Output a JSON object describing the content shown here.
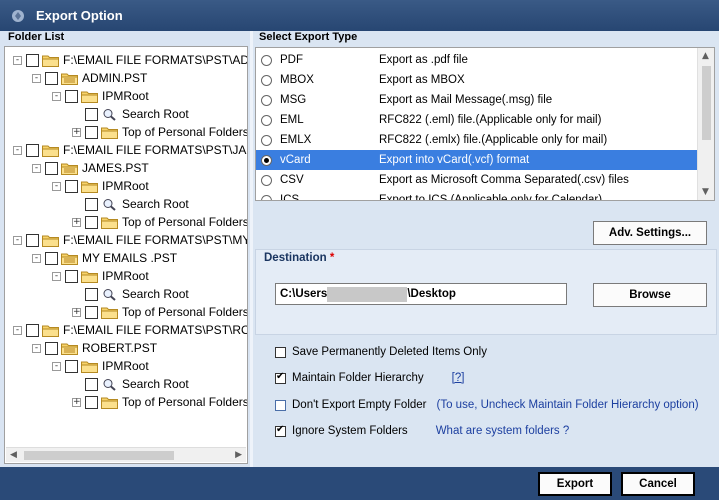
{
  "window": {
    "title": "Export Option"
  },
  "folder_list": {
    "header": "Folder List",
    "tree": [
      {
        "label": "F:\\EMAIL FILE FORMATS\\PST\\ADMIN.PST",
        "level": 0,
        "expander": "-",
        "folder": true
      },
      {
        "label": "ADMIN.PST",
        "level": 1,
        "expander": "-",
        "folder": true,
        "pst": true
      },
      {
        "label": "IPMRoot",
        "level": 2,
        "expander": "-",
        "folder": true
      },
      {
        "label": "Search Root",
        "level": 3,
        "expander": "",
        "search": true
      },
      {
        "label": "Top of Personal Folders",
        "level": 3,
        "expander": "+",
        "folder": true
      },
      {
        "label": "F:\\EMAIL FILE FORMATS\\PST\\JAMES.PST",
        "level": 0,
        "expander": "-",
        "folder": true
      },
      {
        "label": "JAMES.PST",
        "level": 1,
        "expander": "-",
        "folder": true,
        "pst": true
      },
      {
        "label": "IPMRoot",
        "level": 2,
        "expander": "-",
        "folder": true
      },
      {
        "label": "Search Root",
        "level": 3,
        "expander": "",
        "search": true
      },
      {
        "label": "Top of Personal Folders",
        "level": 3,
        "expander": "+",
        "folder": true
      },
      {
        "label": "F:\\EMAIL FILE FORMATS\\PST\\MY EMAILS .PST",
        "level": 0,
        "expander": "-",
        "folder": true
      },
      {
        "label": "MY EMAILS .PST",
        "level": 1,
        "expander": "-",
        "folder": true,
        "pst": true
      },
      {
        "label": "IPMRoot",
        "level": 2,
        "expander": "-",
        "folder": true
      },
      {
        "label": "Search Root",
        "level": 3,
        "expander": "",
        "search": true
      },
      {
        "label": "Top of Personal Folders",
        "level": 3,
        "expander": "+",
        "folder": true
      },
      {
        "label": "F:\\EMAIL FILE FORMATS\\PST\\ROBERT.PST",
        "level": 0,
        "expander": "-",
        "folder": true
      },
      {
        "label": "ROBERT.PST",
        "level": 1,
        "expander": "-",
        "folder": true,
        "pst": true
      },
      {
        "label": "IPMRoot",
        "level": 2,
        "expander": "-",
        "folder": true
      },
      {
        "label": "Search Root",
        "level": 3,
        "expander": "",
        "search": true
      },
      {
        "label": "Top of Personal Folders",
        "level": 3,
        "expander": "+",
        "folder": true
      }
    ]
  },
  "export_types": {
    "header": "Select Export Type",
    "items": [
      {
        "name": "PDF",
        "description": "Export as .pdf file",
        "selected": false
      },
      {
        "name": "MBOX",
        "description": "Export as MBOX",
        "selected": false
      },
      {
        "name": "MSG",
        "description": "Export as Mail Message(.msg) file",
        "selected": false
      },
      {
        "name": "EML",
        "description": "RFC822 (.eml) file.(Applicable only for mail)",
        "selected": false
      },
      {
        "name": "EMLX",
        "description": "RFC822 (.emlx) file.(Applicable only for mail)",
        "selected": false
      },
      {
        "name": "vCard",
        "description": "Export into vCard(.vcf) format",
        "selected": true
      },
      {
        "name": "CSV",
        "description": "Export as Microsoft Comma Separated(.csv) files",
        "selected": false
      },
      {
        "name": "ICS",
        "description": "Export to ICS (Applicable only for Calendar)",
        "selected": false
      }
    ]
  },
  "adv_settings_label": "Adv. Settings...",
  "destination": {
    "label": "Destination",
    "required_mark": "*",
    "path_prefix": "C:\\Users",
    "path_suffix": "\\Desktop",
    "browse_label": "Browse"
  },
  "options": {
    "save_deleted": {
      "label": "Save Permanently Deleted Items Only",
      "checked": false
    },
    "maintain_hierarchy": {
      "label": "Maintain Folder Hierarchy",
      "checked": true,
      "help": "[?]"
    },
    "dont_export_empty": {
      "label": "Don't Export Empty Folder",
      "checked": false,
      "hint": "(To use, Uncheck Maintain Folder Hierarchy option)"
    },
    "ignore_system": {
      "label": "Ignore System Folders",
      "checked": true,
      "link": "What are system folders ?"
    }
  },
  "footer": {
    "export_label": "Export",
    "cancel_label": "Cancel"
  },
  "colors": {
    "titlebar": "#274672",
    "footer": "#2a4a78",
    "selection": "#3a7ee0",
    "panel": "#dae5f2"
  }
}
